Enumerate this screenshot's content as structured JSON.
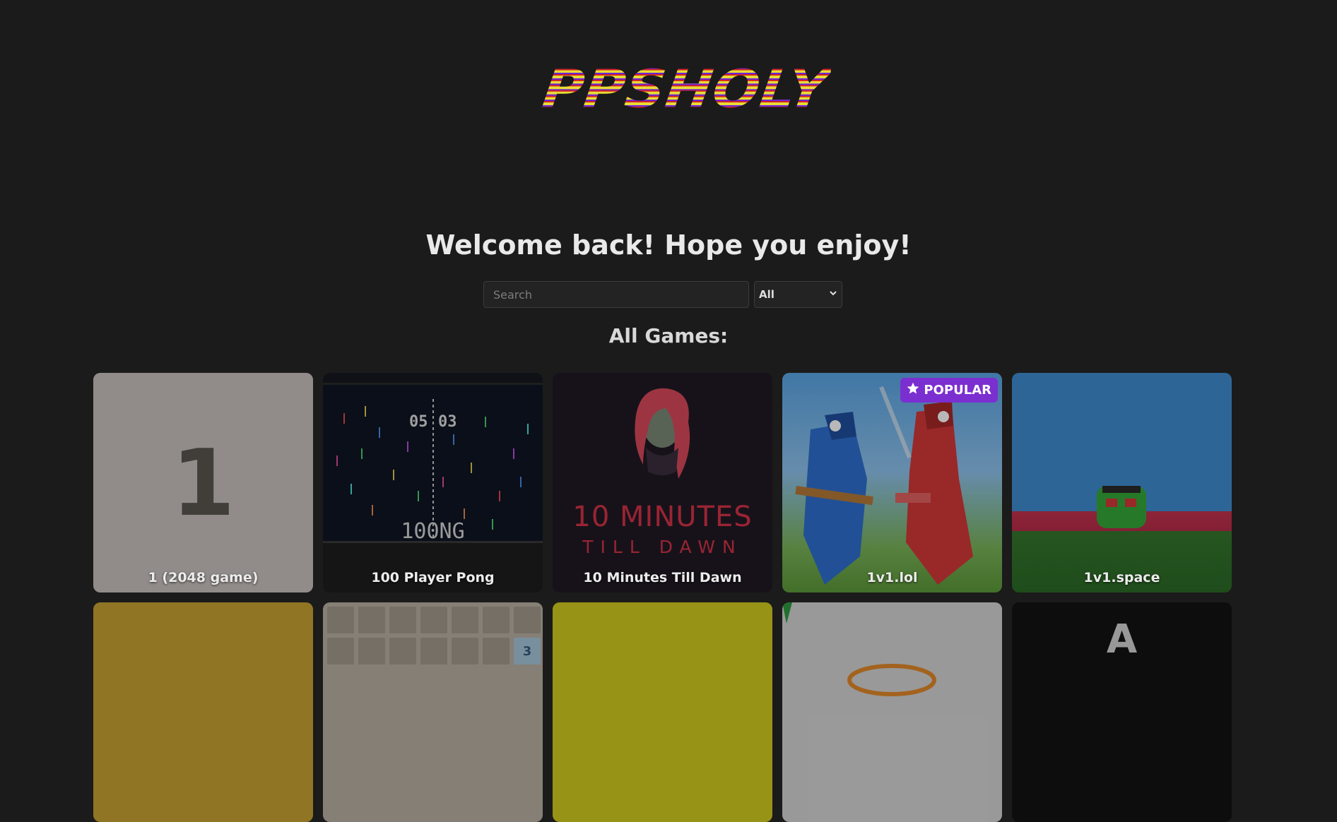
{
  "brand": {
    "logo_text": "PPSHOLY"
  },
  "welcome": {
    "heading": "Welcome back! Hope you enjoy!"
  },
  "search": {
    "placeholder": "Search",
    "value": ""
  },
  "filter": {
    "selected": "All"
  },
  "section": {
    "title": "All Games:"
  },
  "games": [
    {
      "title": "1 (2048 game)",
      "art_text": "1"
    },
    {
      "title": "100 Player Pong",
      "score_left": "05",
      "score_right": "03",
      "art_text": "100NG"
    },
    {
      "title": "10 Minutes Till Dawn",
      "art_title": "10 MINUTES",
      "art_subtitle": "TILL DAWN"
    },
    {
      "title": "1v1.lol",
      "badge": "POPULAR"
    },
    {
      "title": "1v1.space"
    }
  ],
  "row2_art": {
    "cell_number": "3",
    "letter": "A"
  },
  "colors": {
    "background": "#1b1b1b",
    "badge": "#7b2fd0",
    "logo_yellow": "#e8dc34",
    "logo_purple": "#6a23d8",
    "logo_red": "#d52222"
  }
}
